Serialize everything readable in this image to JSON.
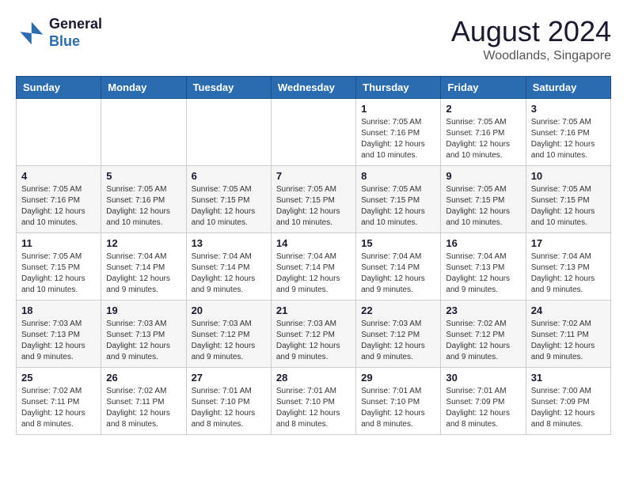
{
  "logo": {
    "line1": "General",
    "line2": "Blue"
  },
  "title": "August 2024",
  "location": "Woodlands, Singapore",
  "days_header": [
    "Sunday",
    "Monday",
    "Tuesday",
    "Wednesday",
    "Thursday",
    "Friday",
    "Saturday"
  ],
  "weeks": [
    [
      {
        "day": "",
        "info": ""
      },
      {
        "day": "",
        "info": ""
      },
      {
        "day": "",
        "info": ""
      },
      {
        "day": "",
        "info": ""
      },
      {
        "day": "1",
        "info": "Sunrise: 7:05 AM\nSunset: 7:16 PM\nDaylight: 12 hours\nand 10 minutes."
      },
      {
        "day": "2",
        "info": "Sunrise: 7:05 AM\nSunset: 7:16 PM\nDaylight: 12 hours\nand 10 minutes."
      },
      {
        "day": "3",
        "info": "Sunrise: 7:05 AM\nSunset: 7:16 PM\nDaylight: 12 hours\nand 10 minutes."
      }
    ],
    [
      {
        "day": "4",
        "info": "Sunrise: 7:05 AM\nSunset: 7:16 PM\nDaylight: 12 hours\nand 10 minutes."
      },
      {
        "day": "5",
        "info": "Sunrise: 7:05 AM\nSunset: 7:16 PM\nDaylight: 12 hours\nand 10 minutes."
      },
      {
        "day": "6",
        "info": "Sunrise: 7:05 AM\nSunset: 7:15 PM\nDaylight: 12 hours\nand 10 minutes."
      },
      {
        "day": "7",
        "info": "Sunrise: 7:05 AM\nSunset: 7:15 PM\nDaylight: 12 hours\nand 10 minutes."
      },
      {
        "day": "8",
        "info": "Sunrise: 7:05 AM\nSunset: 7:15 PM\nDaylight: 12 hours\nand 10 minutes."
      },
      {
        "day": "9",
        "info": "Sunrise: 7:05 AM\nSunset: 7:15 PM\nDaylight: 12 hours\nand 10 minutes."
      },
      {
        "day": "10",
        "info": "Sunrise: 7:05 AM\nSunset: 7:15 PM\nDaylight: 12 hours\nand 10 minutes."
      }
    ],
    [
      {
        "day": "11",
        "info": "Sunrise: 7:05 AM\nSunset: 7:15 PM\nDaylight: 12 hours\nand 10 minutes."
      },
      {
        "day": "12",
        "info": "Sunrise: 7:04 AM\nSunset: 7:14 PM\nDaylight: 12 hours\nand 9 minutes."
      },
      {
        "day": "13",
        "info": "Sunrise: 7:04 AM\nSunset: 7:14 PM\nDaylight: 12 hours\nand 9 minutes."
      },
      {
        "day": "14",
        "info": "Sunrise: 7:04 AM\nSunset: 7:14 PM\nDaylight: 12 hours\nand 9 minutes."
      },
      {
        "day": "15",
        "info": "Sunrise: 7:04 AM\nSunset: 7:14 PM\nDaylight: 12 hours\nand 9 minutes."
      },
      {
        "day": "16",
        "info": "Sunrise: 7:04 AM\nSunset: 7:13 PM\nDaylight: 12 hours\nand 9 minutes."
      },
      {
        "day": "17",
        "info": "Sunrise: 7:04 AM\nSunset: 7:13 PM\nDaylight: 12 hours\nand 9 minutes."
      }
    ],
    [
      {
        "day": "18",
        "info": "Sunrise: 7:03 AM\nSunset: 7:13 PM\nDaylight: 12 hours\nand 9 minutes."
      },
      {
        "day": "19",
        "info": "Sunrise: 7:03 AM\nSunset: 7:13 PM\nDaylight: 12 hours\nand 9 minutes."
      },
      {
        "day": "20",
        "info": "Sunrise: 7:03 AM\nSunset: 7:12 PM\nDaylight: 12 hours\nand 9 minutes."
      },
      {
        "day": "21",
        "info": "Sunrise: 7:03 AM\nSunset: 7:12 PM\nDaylight: 12 hours\nand 9 minutes."
      },
      {
        "day": "22",
        "info": "Sunrise: 7:03 AM\nSunset: 7:12 PM\nDaylight: 12 hours\nand 9 minutes."
      },
      {
        "day": "23",
        "info": "Sunrise: 7:02 AM\nSunset: 7:12 PM\nDaylight: 12 hours\nand 9 minutes."
      },
      {
        "day": "24",
        "info": "Sunrise: 7:02 AM\nSunset: 7:11 PM\nDaylight: 12 hours\nand 9 minutes."
      }
    ],
    [
      {
        "day": "25",
        "info": "Sunrise: 7:02 AM\nSunset: 7:11 PM\nDaylight: 12 hours\nand 8 minutes."
      },
      {
        "day": "26",
        "info": "Sunrise: 7:02 AM\nSunset: 7:11 PM\nDaylight: 12 hours\nand 8 minutes."
      },
      {
        "day": "27",
        "info": "Sunrise: 7:01 AM\nSunset: 7:10 PM\nDaylight: 12 hours\nand 8 minutes."
      },
      {
        "day": "28",
        "info": "Sunrise: 7:01 AM\nSunset: 7:10 PM\nDaylight: 12 hours\nand 8 minutes."
      },
      {
        "day": "29",
        "info": "Sunrise: 7:01 AM\nSunset: 7:10 PM\nDaylight: 12 hours\nand 8 minutes."
      },
      {
        "day": "30",
        "info": "Sunrise: 7:01 AM\nSunset: 7:09 PM\nDaylight: 12 hours\nand 8 minutes."
      },
      {
        "day": "31",
        "info": "Sunrise: 7:00 AM\nSunset: 7:09 PM\nDaylight: 12 hours\nand 8 minutes."
      }
    ]
  ]
}
